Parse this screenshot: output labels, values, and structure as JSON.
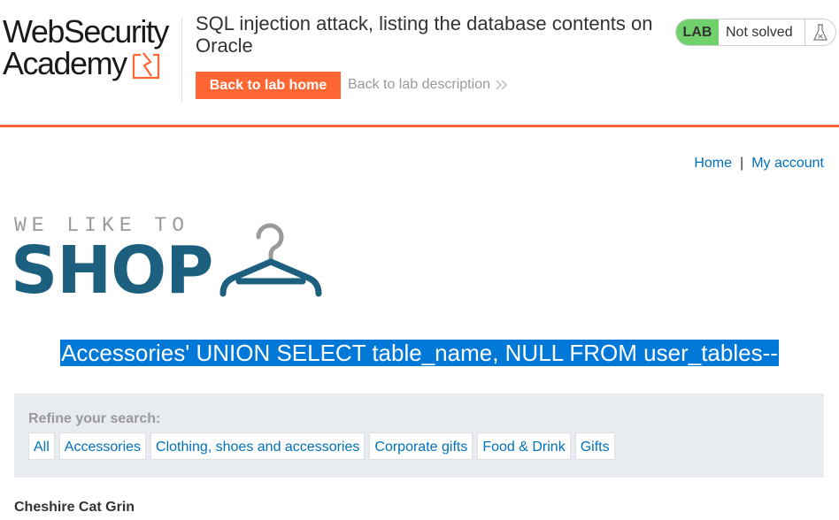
{
  "academy": {
    "logo_line1": "WebSecurity",
    "logo_line2": "Academy"
  },
  "lab": {
    "title": "SQL injection attack, listing the database contents on Oracle",
    "back_home_label": "Back to lab home",
    "back_description_label": "Back to lab description",
    "badge": "LAB",
    "status": "Not solved",
    "accent_color": "#ff6633",
    "badge_color": "#70d16d"
  },
  "nav": {
    "home": "Home",
    "separator": "|",
    "account": "My account"
  },
  "shop": {
    "tagline": "WE LIKE TO",
    "name": "SHOP",
    "brand_color": "#1d5f7f"
  },
  "search": {
    "term": "Accessories' UNION SELECT table_name, NULL FROM user_tables--",
    "highlight_color": "#0078d7"
  },
  "filter": {
    "label": "Refine your search:",
    "categories": [
      "All",
      "Accessories",
      "Clothing, shoes and accessories",
      "Corporate gifts",
      "Food & Drink",
      "Gifts"
    ]
  },
  "products": [
    {
      "name": "Cheshire Cat Grin"
    }
  ],
  "icons": {
    "lab_status": "flask-icon",
    "back_description": "chevron-right-icon",
    "shop_logo": "hanger-icon",
    "academy_logo": "lightning-bolt-icon"
  }
}
